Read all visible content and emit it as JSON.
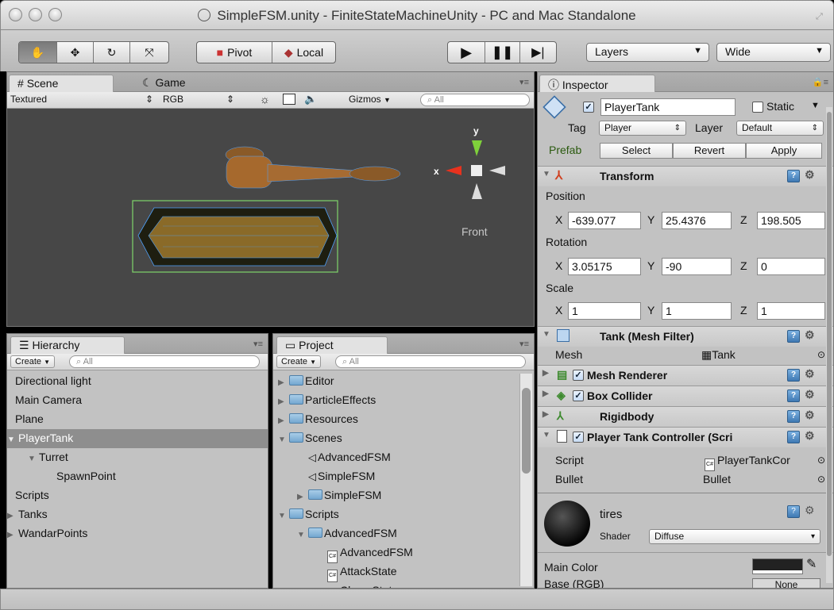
{
  "window": {
    "title": "SimpleFSM.unity - FiniteStateMachineUnity - PC and Mac Standalone"
  },
  "toolbar": {
    "tools": [
      "hand-tool",
      "move-tool",
      "rotate-tool",
      "scale-tool"
    ],
    "pivot_label": "Pivot",
    "local_label": "Local",
    "play_controls": [
      "play",
      "pause",
      "step"
    ],
    "layers_label": "Layers",
    "layout_label": "Wide"
  },
  "scene": {
    "tabs": [
      "Scene",
      "Game"
    ],
    "render_mode": "Textured",
    "channel": "RGB",
    "gizmos_label": "Gizmos",
    "search_placeholder": "All",
    "view_label": "Front",
    "axis_x": "x",
    "axis_y": "y",
    "colors": {
      "background": "#474747",
      "bounds": "#7fd46a",
      "wire": "#4fa3ff"
    }
  },
  "hierarchy": {
    "tab": "Hierarchy",
    "create_label": "Create",
    "search_placeholder": "All",
    "items": [
      {
        "label": "Directional light",
        "depth": 0,
        "expander": "",
        "selected": false
      },
      {
        "label": "Main Camera",
        "depth": 0,
        "expander": "",
        "selected": false
      },
      {
        "label": "Plane",
        "depth": 0,
        "expander": "",
        "selected": false
      },
      {
        "label": "PlayerTank",
        "depth": 0,
        "expander": "▼",
        "selected": true
      },
      {
        "label": "Turret",
        "depth": 1,
        "expander": "▼",
        "selected": false
      },
      {
        "label": "SpawnPoint",
        "depth": 2,
        "expander": "",
        "selected": false
      },
      {
        "label": "Scripts",
        "depth": 0,
        "expander": "",
        "selected": false
      },
      {
        "label": "Tanks",
        "depth": 0,
        "expander": "▶",
        "selected": false
      },
      {
        "label": "WandarPoints",
        "depth": 0,
        "expander": "▶",
        "selected": false
      }
    ]
  },
  "project": {
    "tab": "Project",
    "create_label": "Create",
    "search_placeholder": "All",
    "items": [
      {
        "label": "Editor",
        "depth": 0,
        "expander": "▶",
        "kind": "folder"
      },
      {
        "label": "ParticleEffects",
        "depth": 0,
        "expander": "▶",
        "kind": "folder"
      },
      {
        "label": "Resources",
        "depth": 0,
        "expander": "▶",
        "kind": "folder"
      },
      {
        "label": "Scenes",
        "depth": 0,
        "expander": "▼",
        "kind": "folder"
      },
      {
        "label": "AdvancedFSM",
        "depth": 1,
        "expander": "",
        "kind": "scene"
      },
      {
        "label": "SimpleFSM",
        "depth": 1,
        "expander": "",
        "kind": "scene"
      },
      {
        "label": "SimpleFSM",
        "depth": 1,
        "expander": "▶",
        "kind": "folder"
      },
      {
        "label": "Scripts",
        "depth": 0,
        "expander": "▼",
        "kind": "folder"
      },
      {
        "label": "AdvancedFSM",
        "depth": 1,
        "expander": "▼",
        "kind": "folder"
      },
      {
        "label": "AdvancedFSM",
        "depth": 2,
        "expander": "",
        "kind": "script"
      },
      {
        "label": "AttackState",
        "depth": 2,
        "expander": "",
        "kind": "script"
      },
      {
        "label": "ChaseState",
        "depth": 2,
        "expander": "",
        "kind": "script"
      }
    ]
  },
  "inspector": {
    "tab": "Inspector",
    "object_name": "PlayerTank",
    "static_label": "Static",
    "tag_label": "Tag",
    "tag_value": "Player",
    "layer_label": "Layer",
    "layer_value": "Default",
    "prefab_label": "Prefab",
    "prefab_buttons": [
      "Select",
      "Revert",
      "Apply"
    ],
    "transform": {
      "title": "Transform",
      "position_label": "Position",
      "rotation_label": "Rotation",
      "scale_label": "Scale",
      "position": {
        "x": "-639.077",
        "y": "25.4376",
        "z": "198.505"
      },
      "rotation": {
        "x": "3.05175",
        "y": "-90",
        "z": "0"
      },
      "scale": {
        "x": "1",
        "y": "1",
        "z": "1"
      }
    },
    "mesh_filter": {
      "title": "Tank (Mesh Filter)",
      "mesh_label": "Mesh",
      "mesh_value": "Tank"
    },
    "components": [
      {
        "title": "Mesh Renderer",
        "checkbox": true,
        "icon": "mesh-renderer-icon"
      },
      {
        "title": "Box Collider",
        "checkbox": true,
        "icon": "box-collider-icon"
      },
      {
        "title": "Rigidbody",
        "checkbox": false,
        "icon": "rigidbody-icon"
      }
    ],
    "controller": {
      "title": "Player Tank Controller (Scri",
      "script_label": "Script",
      "script_value": "PlayerTankCor",
      "bullet_label": "Bullet",
      "bullet_value": "Bullet"
    },
    "material": {
      "name": "tires",
      "shader_label": "Shader",
      "shader_value": "Diffuse",
      "main_color_label": "Main Color",
      "base_label": "Base (RGB)",
      "none_label": "None"
    }
  }
}
